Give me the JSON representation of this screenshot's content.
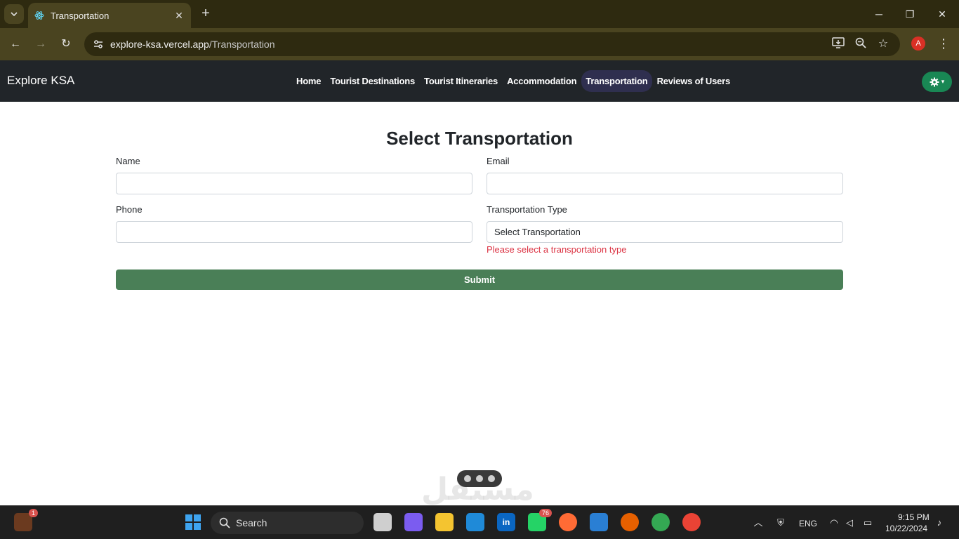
{
  "browser": {
    "tab_title": "Transportation",
    "url_host": "explore-ksa.vercel.app",
    "url_path": "/Transportation",
    "profile_initial": "A"
  },
  "site": {
    "brand": "Explore KSA",
    "nav": [
      {
        "label": "Home",
        "active": false
      },
      {
        "label": "Tourist Destinations",
        "active": false
      },
      {
        "label": "Tourist Itineraries",
        "active": false
      },
      {
        "label": "Accommodation",
        "active": false
      },
      {
        "label": "Transportation",
        "active": true
      },
      {
        "label": "Reviews of Users",
        "active": false
      }
    ]
  },
  "form": {
    "title": "Select Transportation",
    "name_label": "Name",
    "name_value": "",
    "email_label": "Email",
    "email_value": "",
    "phone_label": "Phone",
    "phone_value": "",
    "type_label": "Transportation Type",
    "type_selected": "Select Transportation",
    "type_error": "Please select a transportation type",
    "submit_label": "Submit"
  },
  "watermark": "مستقل",
  "taskbar": {
    "search_label": "Search",
    "notification_count": "1",
    "whatsapp_count": "76",
    "language": "ENG",
    "time": "9:15 PM",
    "date": "10/22/2024"
  },
  "colors": {
    "navbar_bg": "#212529",
    "submit_bg": "#4a7f57",
    "error": "#dc3545",
    "settings_bg": "#198754"
  }
}
